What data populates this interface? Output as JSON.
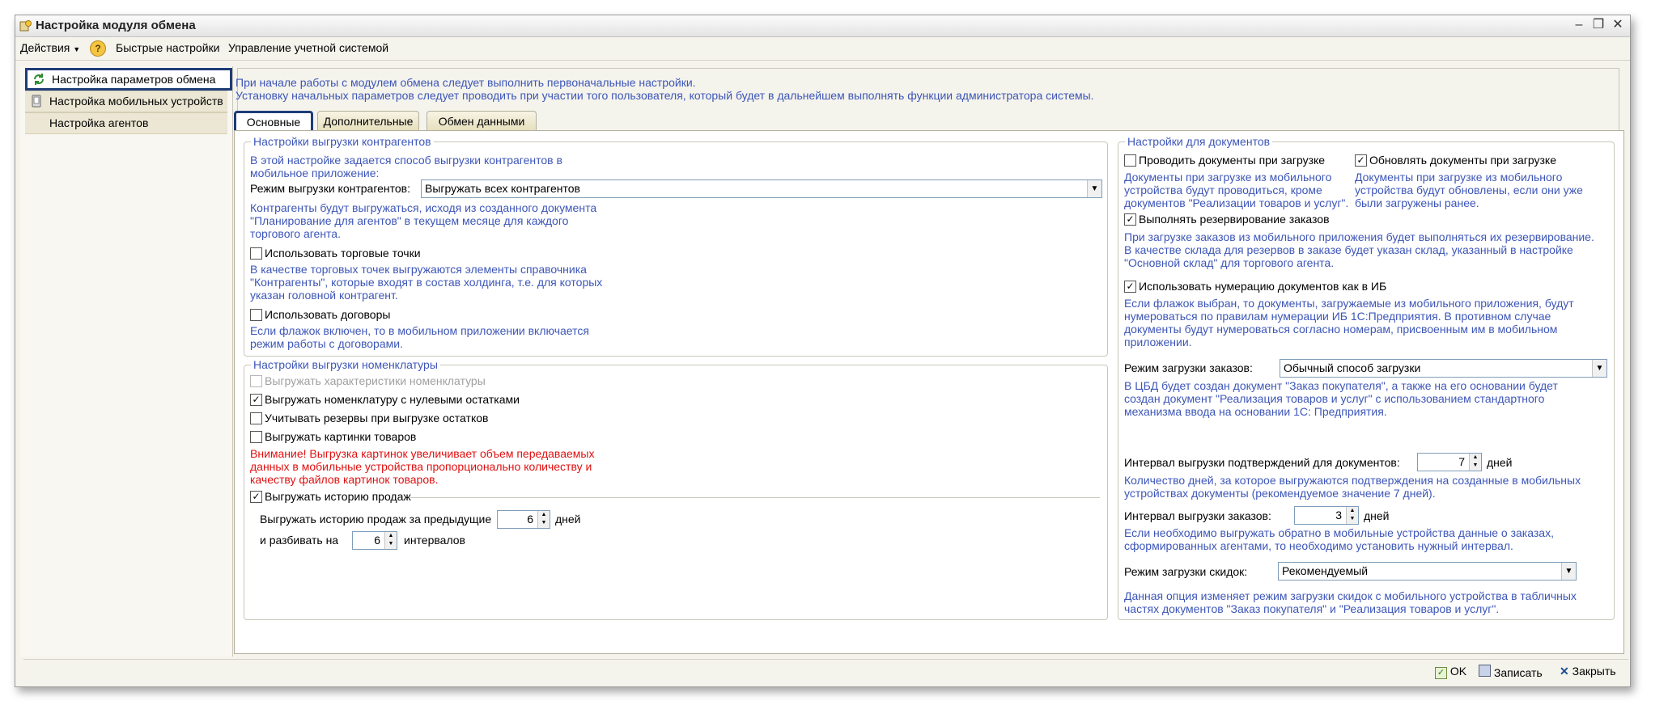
{
  "window": {
    "title": "Настройка модуля обмена"
  },
  "menu": {
    "actions": "Действия",
    "quick_settings": "Быстрые настройки",
    "account_mgmt": "Управление учетной системой"
  },
  "sidebar": {
    "items": [
      {
        "label": "Настройка параметров обмена"
      },
      {
        "label": "Настройка мобильных устройств"
      },
      {
        "label": "Настройка агентов"
      }
    ]
  },
  "intro": {
    "line1": "При начале работы с модулем обмена следует выполнить первоначальные настройки.",
    "line2": "Установку начальных параметров следует проводить при участии того пользователя, который будет в дальнейшем выполнять функции администратора системы."
  },
  "tabs": [
    {
      "label": "Основные"
    },
    {
      "label": "Дополнительные"
    },
    {
      "label": "Обмен данными"
    }
  ],
  "contractors": {
    "title": "Настройки выгрузки контрагентов",
    "desc": [
      "В этой настройке задается способ выгрузки контрагентов в",
      "мобильное приложение:"
    ],
    "mode_label": "Режим выгрузки контрагентов:",
    "mode_value": "Выгружать всех контрагентов",
    "mode_desc": [
      "Контрагенты будут выгружаться, исходя из созданного документа",
      "\"Планирование для агентов\" в текущем месяце для каждого",
      "торгового агента."
    ],
    "trade_points_label": "Использовать торговые точки",
    "trade_points_desc": [
      "В качестве торговых точек выгружаются элементы справочника",
      "\"Контрагенты\", которые входят в состав холдинга, т.е. для которых",
      "указан головной контрагент."
    ],
    "contracts_label": "Использовать договоры",
    "contracts_desc": [
      "Если флажок включен, то в мобильном приложении включается",
      "режим работы с договорами."
    ]
  },
  "nomenclature": {
    "title": "Настройки выгрузки номенклатуры",
    "characteristics": "Выгружать характеристики номенклатуры",
    "zero_stock": "Выгружать номенклатуру с нулевыми остатками",
    "reserves": "Учитывать резервы при выгрузке остатков",
    "pictures": "Выгружать картинки товаров",
    "warning": [
      "Внимание! Выгрузка картинок увеличивает объем передаваемых",
      "данных в мобильные устройства пропорционально количеству и",
      "качеству файлов картинок товаров."
    ],
    "sales_history": "Выгружать историю продаж",
    "history_period_label": "Выгружать историю продаж за предыдущие",
    "history_period_value": "6",
    "history_period_unit": "дней",
    "intervals_label": "и разбивать на",
    "intervals_value": "6",
    "intervals_unit": "интервалов"
  },
  "documents": {
    "title": "Настройки для документов",
    "post_label": "Проводить документы при загрузке",
    "post_desc": [
      "Документы при загрузке из мобильного",
      "устройства будут проводиться, кроме",
      "документов \"Реализации товаров и услуг\"."
    ],
    "update_label": "Обновлять документы при загрузке",
    "update_desc": [
      "Документы при загрузке из мобильного",
      "устройства будут обновлены, если они уже",
      "были загружены ранее."
    ],
    "reserve_label": "Выполнять резервирование заказов",
    "reserve_desc": [
      "При загрузке заказов из мобильного приложения будет выполняться их резервирование.",
      "В качестве склада для резервов в заказе будет указан склад, указанный в настройке",
      "\"Основной склад\" для торгового агента."
    ],
    "numbering_label": "Использовать нумерацию документов как в ИБ",
    "numbering_desc": [
      "Если флажок выбран, то документы, загружаемые из мобильного приложения, будут",
      "нумероваться по правилам нумерации ИБ 1С:Предприятия.  В противном случае",
      "документы будут нумероваться согласно номерам, присвоенным им в мобильном",
      "приложении."
    ],
    "order_mode_label": "Режим загрузки заказов:",
    "order_mode_value": "Обычный способ загрузки",
    "order_mode_desc": [
      "В ЦБД будет создан документ \"Заказ покупателя\", а также на его основании будет",
      "создан документ \"Реализация товаров и услуг\" с использованием стандартного",
      "механизма ввода на основании 1С: Предприятия."
    ],
    "confirm_interval_label": "Интервал выгрузки подтверждений для документов:",
    "confirm_interval_value": "7",
    "confirm_interval_unit": "дней",
    "confirm_interval_desc": [
      "Количество дней, за которое выгружаются подтверждения на созданные в мобильных",
      "устройствах документы (рекомендуемое значение 7 дней)."
    ],
    "orders_interval_label": "Интервал выгрузки заказов:",
    "orders_interval_value": "3",
    "orders_interval_unit": "дней",
    "orders_interval_desc": [
      "Если необходимо выгружать обратно в мобильные устройства данные о заказах,",
      "сформированных агентами, то необходимо установить нужный интервал."
    ],
    "discount_mode_label": "Режим загрузки скидок:",
    "discount_mode_value": "Рекомендуемый",
    "discount_desc": [
      "Данная опция изменяет режим загрузки скидок с мобильного устройства в табличных",
      "частях документов \"Заказ покупателя\" и \"Реализация товаров и услуг\"."
    ]
  },
  "footer": {
    "ok": "OK",
    "save": "Записать",
    "close": "Закрыть"
  },
  "colors": {
    "hint_text": "#3d56b8",
    "warning_text": "#e01010",
    "selection_border": "#1f3c78"
  }
}
